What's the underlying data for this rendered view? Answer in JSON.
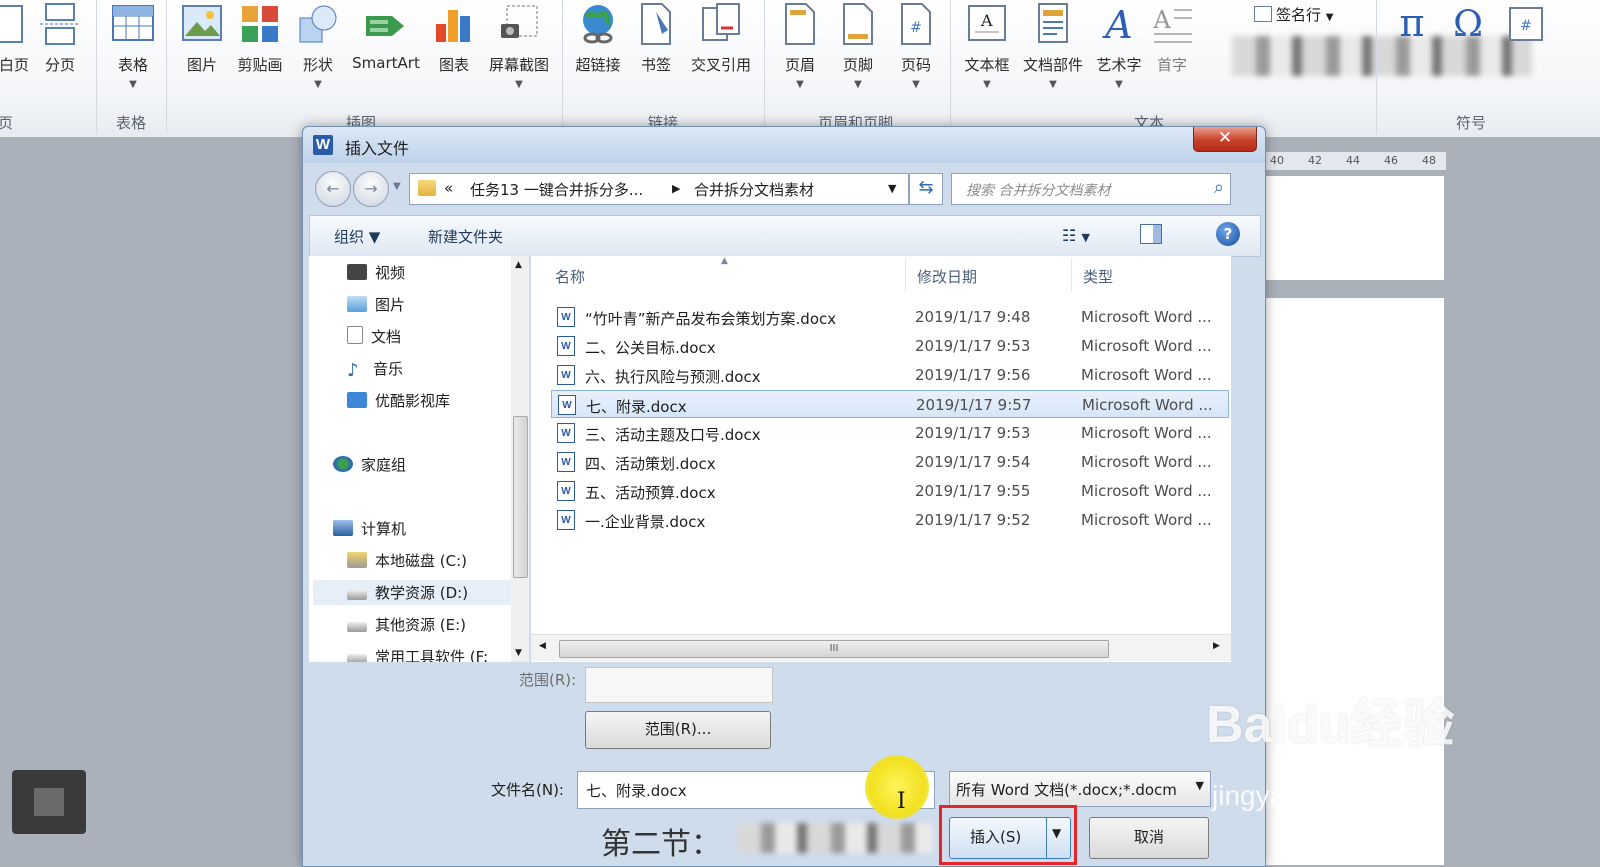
{
  "ribbon": {
    "buttons": [
      {
        "label": "白页",
        "icon": "blank-page-icon"
      },
      {
        "label": "分页",
        "icon": "page-break-icon"
      },
      {
        "label": "表格",
        "icon": "table-icon"
      },
      {
        "label": "图片",
        "icon": "picture-icon"
      },
      {
        "label": "剪贴画",
        "icon": "clipart-icon"
      },
      {
        "label": "形状",
        "icon": "shapes-icon"
      },
      {
        "label": "SmartArt",
        "icon": "smartart-icon"
      },
      {
        "label": "图表",
        "icon": "chart-icon"
      },
      {
        "label": "屏幕截图",
        "icon": "screenshot-icon"
      },
      {
        "label": "超链接",
        "icon": "hyperlink-icon"
      },
      {
        "label": "书签",
        "icon": "bookmark-icon"
      },
      {
        "label": "交叉引用",
        "icon": "cross-reference-icon"
      },
      {
        "label": "页眉",
        "icon": "header-icon"
      },
      {
        "label": "页脚",
        "icon": "footer-icon"
      },
      {
        "label": "页码",
        "icon": "page-number-icon"
      },
      {
        "label": "文本框",
        "icon": "textbox-icon"
      },
      {
        "label": "文档部件",
        "icon": "quick-parts-icon"
      },
      {
        "label": "艺术字",
        "icon": "wordart-icon"
      },
      {
        "label": "首字",
        "icon": "dropcap-icon"
      }
    ],
    "signature_line": "签名行",
    "groups": {
      "pages": "页",
      "tables": "表格",
      "illustrations": "插图",
      "links": "链接",
      "header_footer": "页眉和页脚",
      "text": "文本",
      "symbols": "符号"
    },
    "ruler_ticks": [
      "40",
      "42",
      "44",
      "46",
      "48"
    ]
  },
  "dialog": {
    "title": "插入文件",
    "close_label": "✕",
    "address": {
      "overflow": "«",
      "crumb1": "任务13 一键合并拆分多...",
      "crumb2": "合并拆分文档素材"
    },
    "search_placeholder": "搜索 合并拆分文档素材",
    "toolbar": {
      "organize": "组织 ▼",
      "new_folder": "新建文件夹"
    },
    "nav_items": [
      "视频",
      "图片",
      "文档",
      "音乐",
      "优酷影视库",
      "家庭组",
      "计算机",
      "本地磁盘 (C:)",
      "教学资源 (D:)",
      "其他资源 (E:)",
      "常用工具软件 (F:"
    ],
    "columns": {
      "name": "名称",
      "date": "修改日期",
      "type": "类型"
    },
    "files": [
      {
        "name": "“竹叶青”新产品发布会策划方案.docx",
        "date": "2019/1/17 9:48",
        "type": "Microsoft Word ..."
      },
      {
        "name": "二、公关目标.docx",
        "date": "2019/1/17 9:53",
        "type": "Microsoft Word ..."
      },
      {
        "name": "六、执行风险与预测.docx",
        "date": "2019/1/17 9:56",
        "type": "Microsoft Word ..."
      },
      {
        "name": "七、附录.docx",
        "date": "2019/1/17 9:57",
        "type": "Microsoft Word ..."
      },
      {
        "name": "三、活动主题及口号.docx",
        "date": "2019/1/17 9:53",
        "type": "Microsoft Word ..."
      },
      {
        "name": "四、活动策划.docx",
        "date": "2019/1/17 9:54",
        "type": "Microsoft Word ..."
      },
      {
        "name": "五、活动预算.docx",
        "date": "2019/1/17 9:55",
        "type": "Microsoft Word ..."
      },
      {
        "name": "一.企业背景.docx",
        "date": "2019/1/17 9:52",
        "type": "Microsoft Word ..."
      }
    ],
    "selected_file": "七、附录.docx",
    "range_label": "范围(R):",
    "range_button": "范围(R)...",
    "filename_label": "文件名(N):",
    "filename_value": "七、附录.docx",
    "filetype_value": "所有 Word 文档(*.docx;*.docm",
    "insert_button": "插入(S)",
    "cancel_button": "取消"
  },
  "background_text": "第二节：",
  "watermark": {
    "line1": "Baidu经验",
    "line2": "jingyan.baidu.com"
  },
  "colors": {
    "accent": "#2a5caa",
    "selection": "#d6e6f8",
    "highlight_box": "#e2262a",
    "cursor_highlight": "#f2e120"
  }
}
